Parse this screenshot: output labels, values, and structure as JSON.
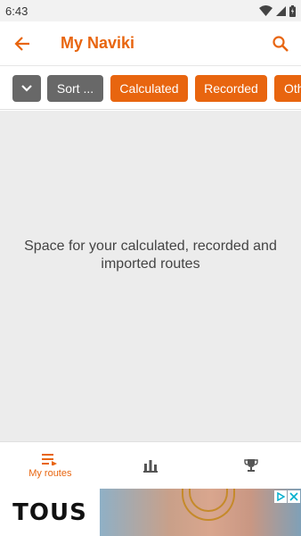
{
  "status_bar": {
    "time": "6:43"
  },
  "app_bar": {
    "title": "My Naviki"
  },
  "filters": {
    "sort_label": "Sort ...",
    "chips": [
      "Calculated",
      "Recorded",
      "Oth"
    ]
  },
  "content": {
    "empty_message": "Space for your calculated, recorded and imported routes"
  },
  "bottom_nav": {
    "my_routes_label": "My routes"
  },
  "ad": {
    "brand": "TOUS"
  },
  "colors": {
    "accent": "#e8650f",
    "chip_grey": "#686868",
    "content_bg": "#ececec"
  }
}
